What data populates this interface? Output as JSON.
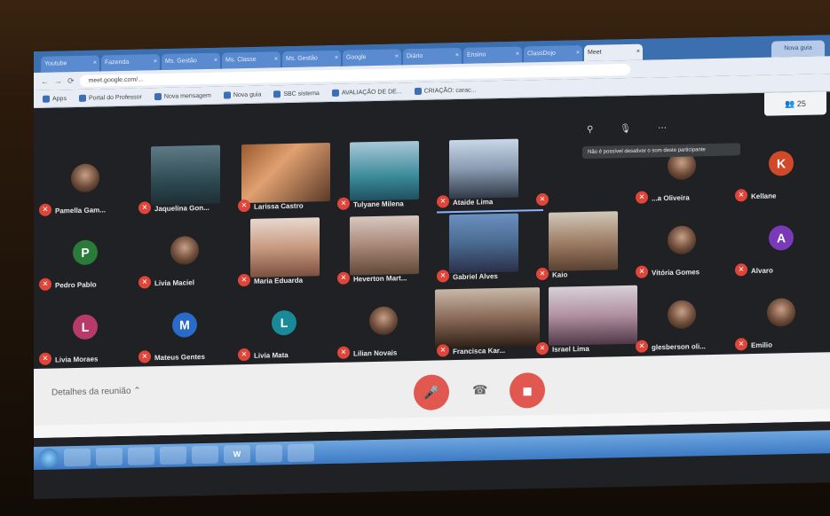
{
  "browser": {
    "tabs": [
      "Youtube",
      "Fazenda",
      "Ms. Gestão",
      "Ms. Classe",
      "Ms. Gestão",
      "Google",
      "Diário",
      "Ensino",
      "ClassDojo",
      "Meet"
    ],
    "active_tab_index": 9,
    "new_tab_label": "Nova guia",
    "url": "meet.google.com/..."
  },
  "bookmarks": [
    "Apps",
    "Portal do Professor",
    "Nova mensagem",
    "Nova guia",
    "SBC sistema ",
    "AVALIAÇÃO DE DE...",
    "CRIAÇÃO: carac..."
  ],
  "participant_count": "25",
  "participants": [
    {
      "name": "Pamella Gam...",
      "type": "photo",
      "row": 0,
      "col": 0
    },
    {
      "name": "Jaquelina Gon...",
      "type": "video",
      "video": "v1",
      "row": 0,
      "col": 1
    },
    {
      "name": "Larissa Castro",
      "type": "video",
      "video": "v2",
      "row": 0,
      "col": 2
    },
    {
      "name": "Tulyane Milena",
      "type": "video",
      "video": "v3",
      "row": 0,
      "col": 3
    },
    {
      "name": "Ataide Lima",
      "type": "video",
      "video": "v4",
      "row": 0,
      "col": 4,
      "speaking": true
    },
    {
      "name": "",
      "type": "hover",
      "row": 0,
      "col": 5
    },
    {
      "name": "...a Oliveira",
      "type": "photo",
      "row": 0,
      "col": 6
    },
    {
      "name": "Kellane",
      "type": "letter",
      "letter": "K",
      "color": "#d04a2a",
      "row": 0,
      "col": 7
    },
    {
      "name": "Pedro Pablo",
      "type": "letter",
      "letter": "P",
      "color": "#2a7a3a",
      "row": 1,
      "col": 0
    },
    {
      "name": "Livia Maciel",
      "type": "photo",
      "row": 1,
      "col": 1
    },
    {
      "name": "Maria Eduarda",
      "type": "video",
      "video": "v5",
      "row": 1,
      "col": 2
    },
    {
      "name": "Heverton Mart...",
      "type": "video",
      "video": "v6",
      "row": 1,
      "col": 3
    },
    {
      "name": "Gabriel Alves",
      "type": "video",
      "video": "v7",
      "row": 1,
      "col": 4
    },
    {
      "name": "Kaio",
      "type": "video",
      "video": "v8",
      "row": 1,
      "col": 5
    },
    {
      "name": "Vitória Gomes",
      "type": "photo",
      "row": 1,
      "col": 6
    },
    {
      "name": "Alvaro",
      "type": "letter",
      "letter": "A",
      "color": "#7a3ab8",
      "row": 1,
      "col": 7
    },
    {
      "name": "Livia Moraes",
      "type": "letter",
      "letter": "L",
      "color": "#b83a6a",
      "row": 2,
      "col": 0
    },
    {
      "name": "Mateus Gentes",
      "type": "letter",
      "letter": "M",
      "color": "#2a6ac8",
      "row": 2,
      "col": 1
    },
    {
      "name": "Livia Mata",
      "type": "letter",
      "letter": "L",
      "color": "#1a8a9a",
      "row": 2,
      "col": 2
    },
    {
      "name": "Lilian Novais",
      "type": "photo",
      "row": 2,
      "col": 3
    },
    {
      "name": "Francisca Kar...",
      "type": "video",
      "video": "v9",
      "row": 2,
      "col": 4
    },
    {
      "name": "Israel Lima",
      "type": "video",
      "video": "v10",
      "row": 2,
      "col": 5
    },
    {
      "name": "glesberson oli...",
      "type": "photo",
      "row": 2,
      "col": 6
    },
    {
      "name": "Emilio",
      "type": "photo",
      "row": 2,
      "col": 7
    }
  ],
  "hover_tooltip": "Não é possível desativar o som deste participante",
  "bottombar": {
    "meeting_details": "Detalhes da reunião",
    "mic_icon": "mic-off-icon",
    "cam_icon": "cam-off-icon"
  },
  "taskbar": {
    "apps": [
      "",
      "",
      "",
      "",
      "",
      "W",
      "",
      ""
    ],
    "clock": ""
  }
}
